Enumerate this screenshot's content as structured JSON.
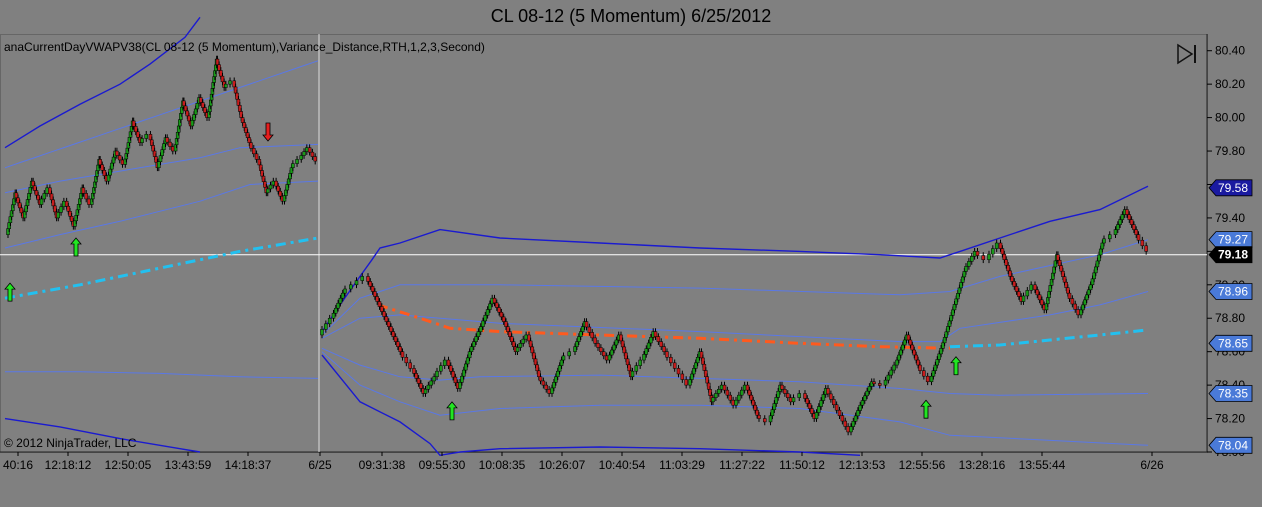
{
  "window": {
    "title": "CL 08-12 (5 Momentum)  6/25/2012",
    "indicator_label": "anaCurrentDayVWAPV38(CL  08-12  (5  Momentum),Variance_Distance,RTH,1,2,3,Second)",
    "copyright": "© 2012 NinjaTrader, LLC"
  },
  "colors": {
    "background": "#808080",
    "axis_panel": "#808080",
    "candle_up": "#1a9a1a",
    "candle_down": "#c81e1e",
    "band_dark": "#1a1ad0",
    "band_light": "#5a78e6",
    "vwap_prev": "#22c0f0",
    "vwap_current": "#ff5a1e",
    "arrow_up": "#22e622",
    "arrow_down": "#e61e1e",
    "current_price_line": "#ffffff",
    "label_blue": "#4a7ad8",
    "label_navy": "#1a1aa0",
    "label_black": "#000000"
  },
  "chart_data": {
    "type": "candlestick",
    "title": "CL 08-12 (5 Momentum)  6/25/2012",
    "instrument": "CL 08-12",
    "bar_type": "5 Momentum",
    "y_range": [
      78.0,
      80.5
    ],
    "y_ticks": [
      "80.40",
      "80.20",
      "80.00",
      "79.80",
      "79.60",
      "79.40",
      "79.20",
      "79.00",
      "78.80",
      "78.60",
      "78.40",
      "78.20",
      "78.00"
    ],
    "x_tick_labels": [
      "40:16",
      "12:18:12",
      "12:50:05",
      "13:43:59",
      "14:18:37",
      "6/25",
      "09:31:38",
      "09:55:30",
      "10:08:35",
      "10:26:07",
      "10:40:54",
      "11:03:29",
      "11:27:22",
      "11:50:12",
      "12:13:53",
      "12:55:56",
      "13:28:16",
      "13:55:44",
      "6/26"
    ],
    "session_price_path": [
      [
        79.3,
        79.55,
        79.4,
        79.62,
        79.48,
        79.58,
        79.4,
        79.5,
        79.35,
        79.58,
        79.48,
        79.75,
        79.62,
        79.8,
        79.72,
        79.98,
        79.85,
        79.9,
        79.7,
        79.88,
        79.8,
        80.1,
        79.95,
        80.12,
        80.0,
        80.35,
        80.18,
        80.22,
        80.0,
        79.85,
        79.75,
        79.55,
        79.62,
        79.5,
        79.7,
        79.75,
        79.82,
        79.74
      ],
      [
        78.7,
        78.8,
        78.95,
        79.0,
        79.05,
        78.9,
        78.75,
        78.6,
        78.5,
        78.35,
        78.45,
        78.55,
        78.38,
        78.6,
        78.75,
        78.92,
        78.78,
        78.6,
        78.7,
        78.45,
        78.35,
        78.55,
        78.6,
        78.78,
        78.65,
        78.55,
        78.7,
        78.45,
        78.55,
        78.72,
        78.6,
        78.5,
        78.4,
        78.6,
        78.3,
        78.4,
        78.28,
        78.4,
        78.22,
        78.18,
        78.4,
        78.3,
        78.35,
        78.2,
        78.38,
        78.25,
        78.12,
        78.28,
        78.42,
        78.4,
        78.52,
        78.7,
        78.52,
        78.42,
        78.62,
        78.85,
        79.08,
        79.2,
        79.15,
        79.25,
        79.05,
        78.9,
        79.0,
        78.85,
        79.18,
        78.95,
        78.82,
        79.0,
        79.25,
        79.3,
        79.45,
        79.3,
        79.2
      ]
    ],
    "reference_levels": {
      "current_price": "79.18",
      "upper_band_3": "79.58",
      "upper_band_2": "79.27",
      "upper_band_1": "78.96",
      "vwap": "78.65",
      "lower_band_1": "78.35",
      "lower_band_2": "78.04"
    },
    "up_arrow_prices": [
      79.22,
      78.95,
      78.24,
      78.25,
      78.51
    ],
    "down_arrow_prices": [
      79.92
    ]
  }
}
